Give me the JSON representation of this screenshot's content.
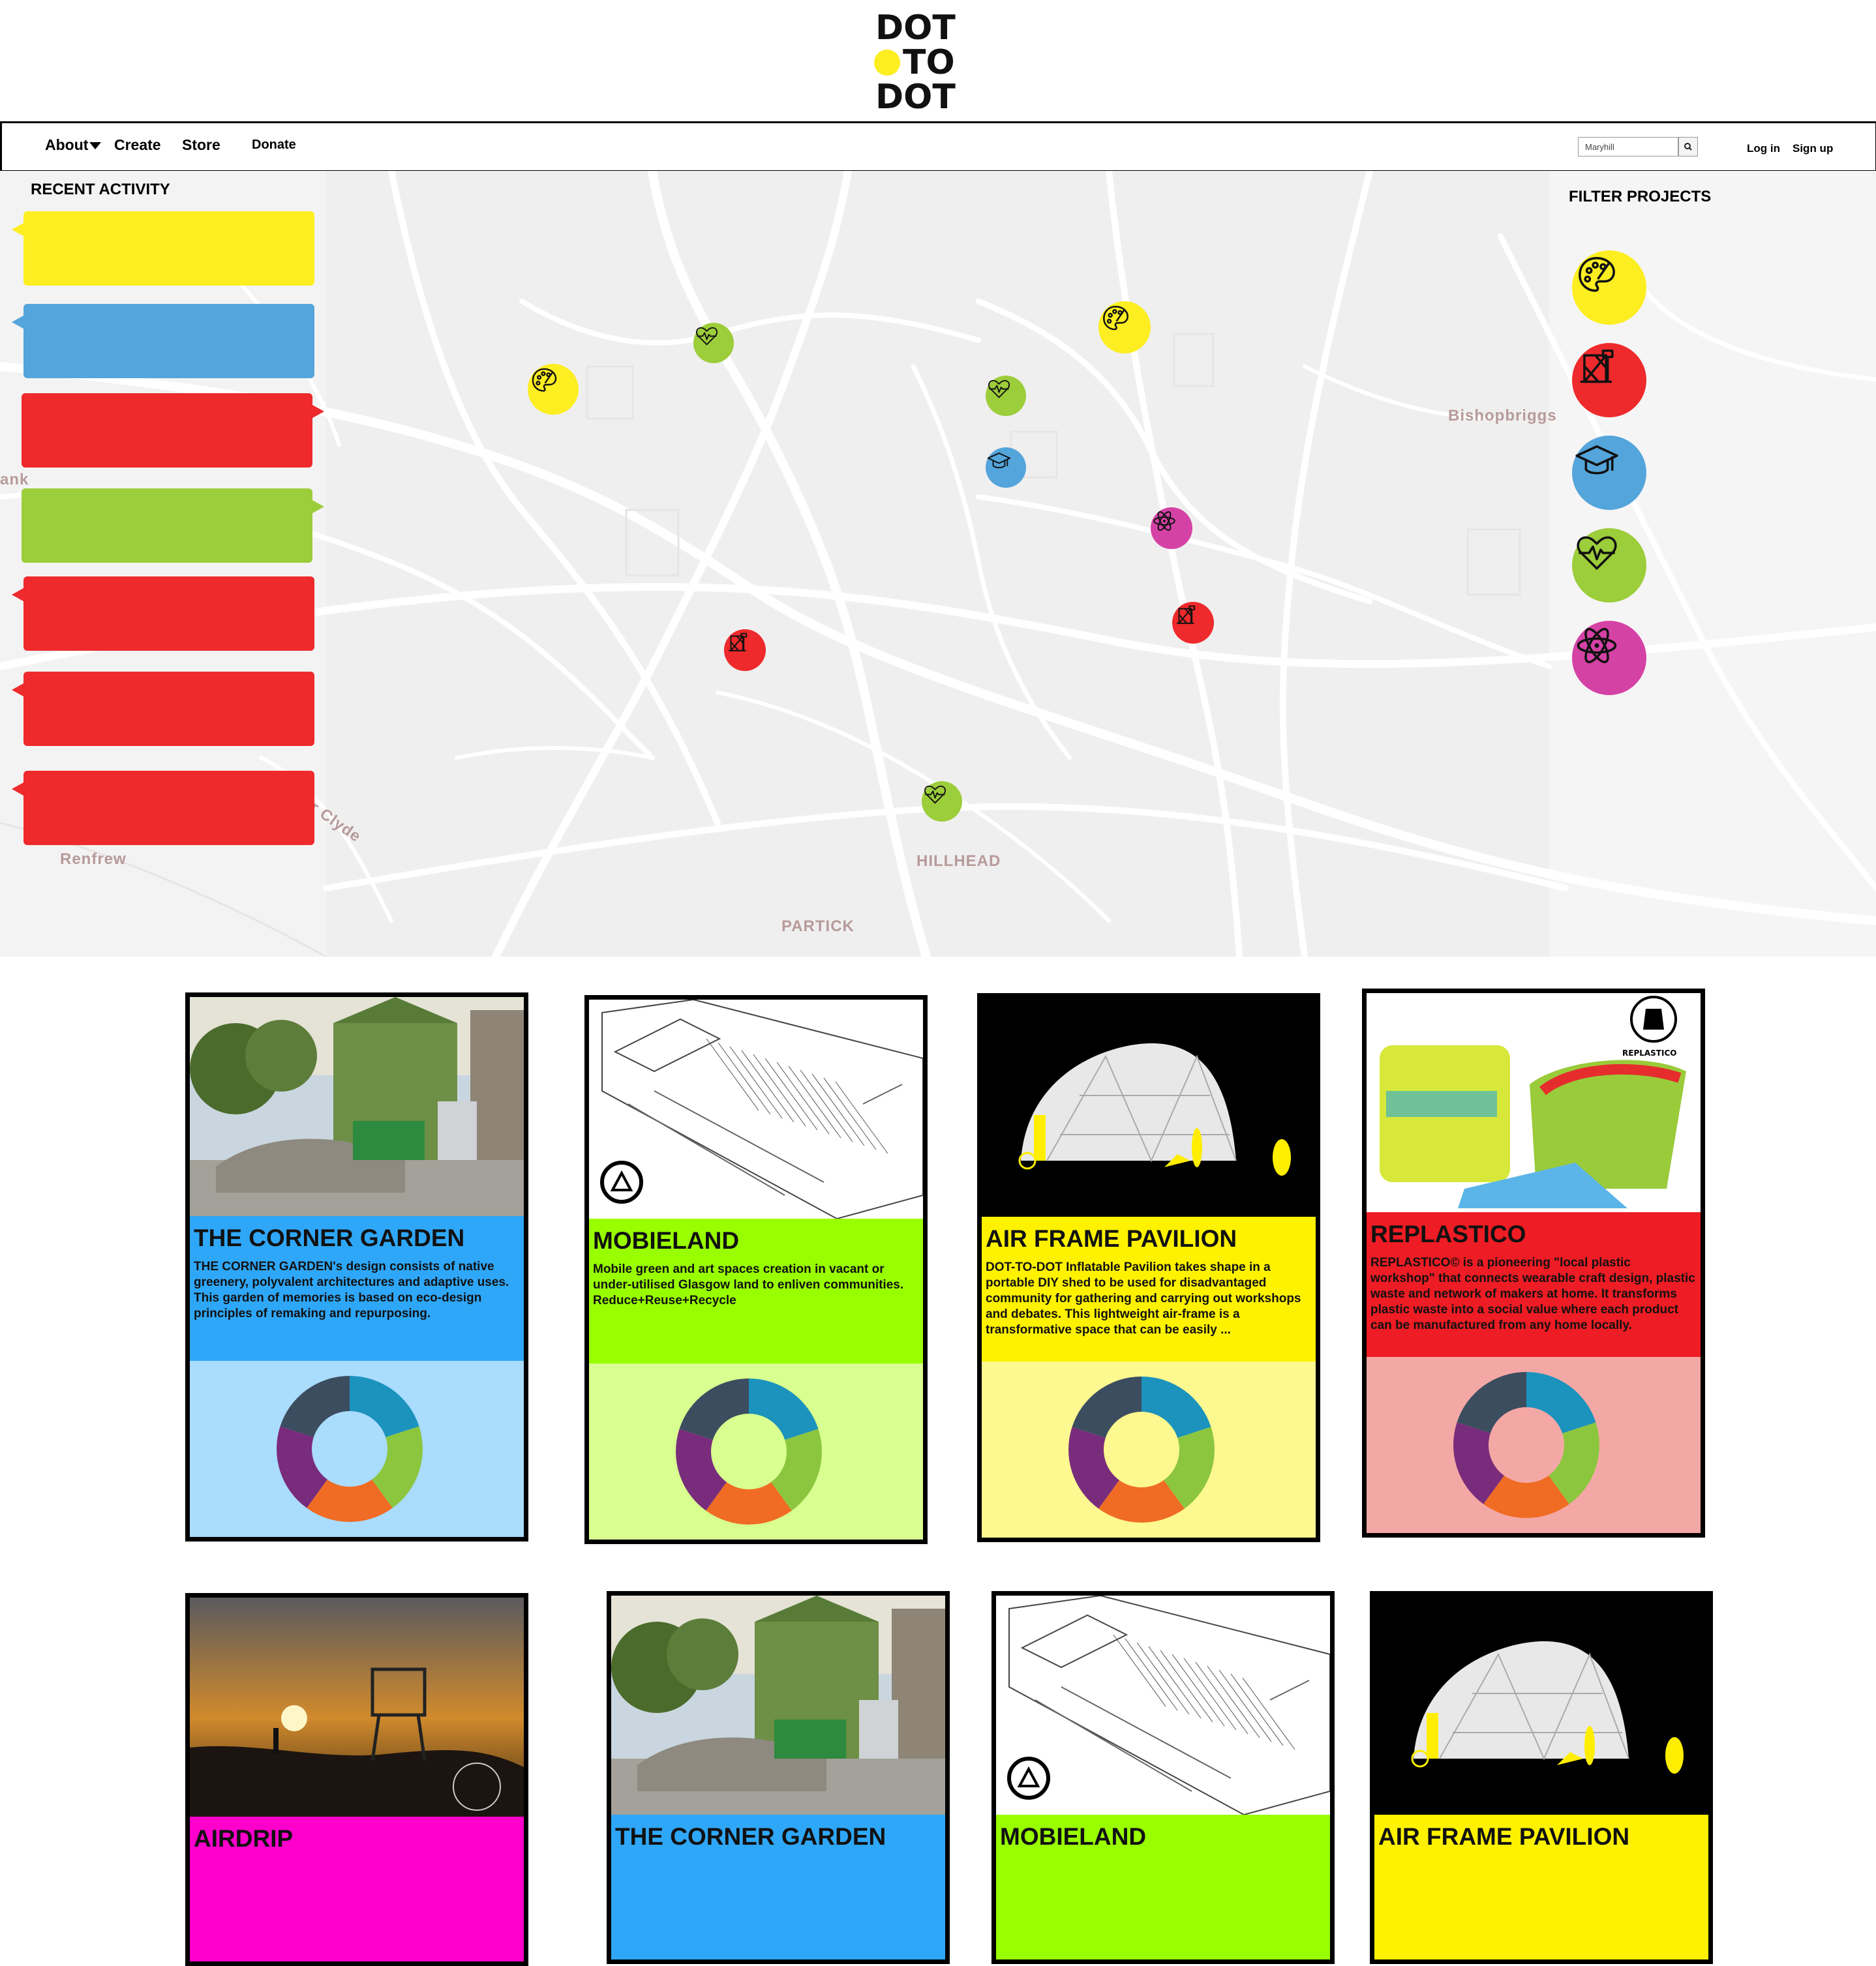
{
  "logo": {
    "rows": [
      "DOT",
      "TO",
      "DOT"
    ]
  },
  "nav": {
    "about": "About",
    "create": "Create",
    "store": "Store",
    "donate": "Donate",
    "search_value": "Maryhill",
    "login": "Log in",
    "signup": "Sign up"
  },
  "map": {
    "recent_title": "RECENT ACTIVITY",
    "filter_title": "FILTER PROJECTS",
    "labels": {
      "bishopbriggs": "Bishopbriggs",
      "renfrew": "Renfrew",
      "hillhead": "HILLHEAD",
      "partick": "PARTICK",
      "clyde": "r Clyde",
      "ank": "ank"
    },
    "activity_colors": [
      "#fcee21",
      "#54a5db",
      "#ee2a2c",
      "#9ccd3a",
      "#ee2a2c",
      "#ee2a2c",
      "#ee2a2c"
    ],
    "filters": [
      {
        "icon": "palette-icon",
        "color": "#fcee21"
      },
      {
        "icon": "construction-icon",
        "color": "#ee2a2c"
      },
      {
        "icon": "graduation-cap-icon",
        "color": "#54a5db"
      },
      {
        "icon": "heartbeat-icon",
        "color": "#9ccd3a"
      },
      {
        "icon": "atom-icon",
        "color": "#d542a5"
      }
    ]
  },
  "cards": [
    {
      "title": "THE CORNER GARDEN",
      "desc": "THE CORNER GARDEN's design consists of native greenery, polyvalent architectures and adaptive uses. This garden of memories is based on eco-design principles of remaking and repurposing.",
      "color": "#2fa7f8",
      "light": "#aadcfd"
    },
    {
      "title": "MOBIELAND",
      "desc": "Mobile green and art spaces creation in vacant or under-utilised Glasgow land to enliven communities. Reduce+Reuse+Recycle",
      "color": "#99ff00",
      "light": "#d8ff8f"
    },
    {
      "title": "AIR FRAME PAVILION",
      "desc": "DOT-TO-DOT Inflatable Pavilion takes shape in a portable DIY shed to be used for disadvantaged community for gathering and carrying out workshops and debates. This lightweight air-frame is a transformative space that can be easily ...",
      "color": "#fff200",
      "light": "#fdf88f"
    },
    {
      "title": "REPLASTICO",
      "desc": "REPLASTICO© is a pioneering \"local plastic workshop\" that connects wearable craft design, plastic waste and network of makers at home. It transforms plastic waste into a social value where each product can be manufactured from any home locally.",
      "color": "#ee1c24",
      "light": "#f4a8a5"
    },
    {
      "title": "AIRDRIP",
      "color": "#ff00cc"
    },
    {
      "title": "THE CORNER GARDEN",
      "color": "#2fa7f8"
    },
    {
      "title": "MOBIELAND",
      "color": "#99ff00"
    },
    {
      "title": "AIR FRAME PAVILION",
      "color": "#fff200"
    }
  ],
  "replastico_badge": "REPLASTICO",
  "chart_segment_colors": [
    "#1b93bd",
    "#8cc63f",
    "#f06b23",
    "#7a2c7c",
    "#3c4d60"
  ]
}
